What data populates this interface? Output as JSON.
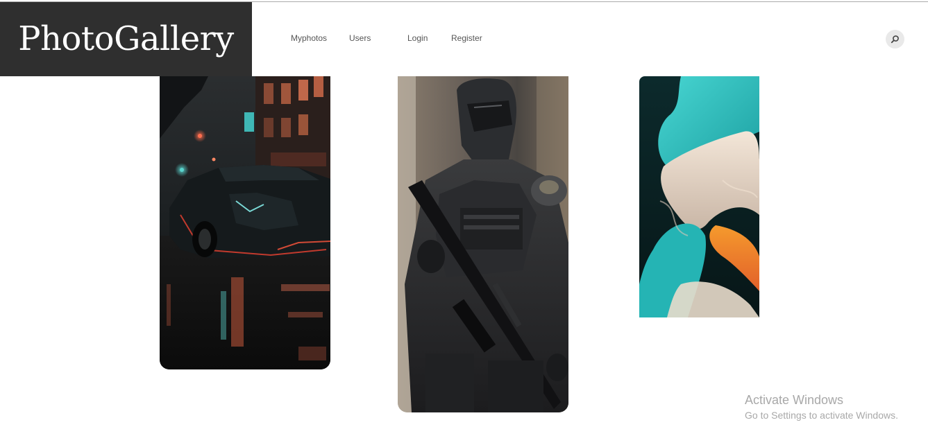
{
  "brand": {
    "title": "PhotoGallery"
  },
  "nav": {
    "items": [
      {
        "label": "Myphotos"
      },
      {
        "label": "Users"
      },
      {
        "label": "Login"
      },
      {
        "label": "Register"
      }
    ]
  },
  "search": {
    "icon": "search-icon"
  },
  "gallery": {
    "photos": [
      {
        "subject": "sports car on rainy night street"
      },
      {
        "subject": "armored soldier with rifle"
      },
      {
        "subject": "teal and orange smoke swirl"
      }
    ]
  },
  "watermark": {
    "title": "Activate Windows",
    "subtitle": "Go to Settings to activate Windows."
  },
  "colors": {
    "header_bg": "#2f2f2f",
    "nav_text": "#555555",
    "search_bg": "#e9e9e9"
  }
}
